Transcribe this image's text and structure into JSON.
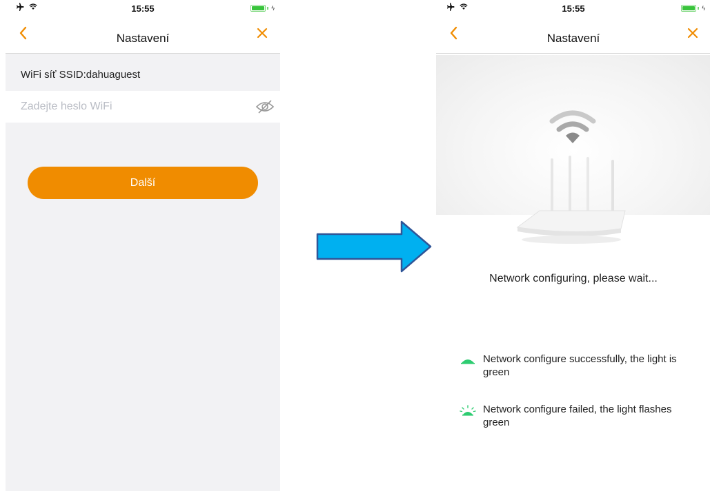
{
  "left_screen": {
    "status_bar": {
      "time": "15:55"
    },
    "nav": {
      "title": "Nastavení"
    },
    "ssid_label": "WiFi síť SSID:dahuaguest",
    "password_input": {
      "placeholder": "Zadejte heslo WiFi",
      "value": ""
    },
    "next_button": "Další"
  },
  "right_screen": {
    "status_bar": {
      "time": "15:55"
    },
    "nav": {
      "title": "Nastavení"
    },
    "status_message": "Network configuring, please wait...",
    "legend": [
      {
        "icon": "green-lamp-steady-icon",
        "text": "Network configure successfully, the light is green"
      },
      {
        "icon": "green-lamp-flashing-icon",
        "text": "Network configure failed, the light flashes green"
      }
    ]
  },
  "colors": {
    "accent": "#f08c00",
    "arrow_fill": "#00b0f0",
    "arrow_stroke": "#2f5597",
    "lamp_green": "#2ecc71"
  }
}
